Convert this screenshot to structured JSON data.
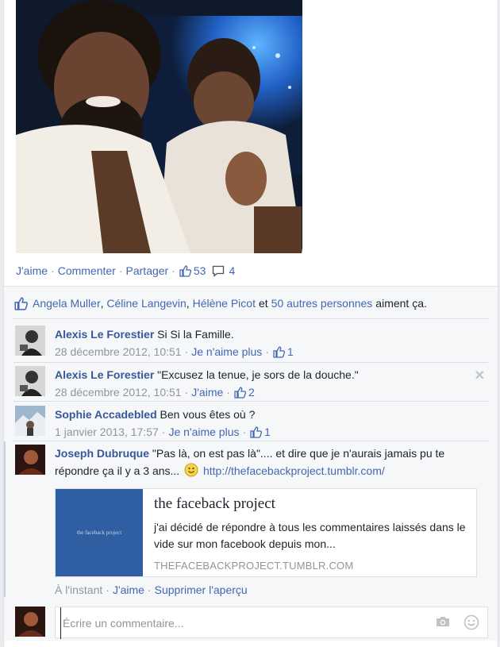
{
  "post": {
    "photo_alt": "",
    "actions": {
      "like": "J'aime",
      "comment": "Commenter",
      "share": "Partager",
      "like_count": "53",
      "comment_count": "4"
    },
    "likes": {
      "name1": "Angela Muller",
      "name2": "Céline Langevin",
      "name3": "Hélène Picot",
      "conj": "et",
      "others": "50 autres personnes",
      "suffix": "aiment ça."
    }
  },
  "comments": [
    {
      "author": "Alexis Le Forestier",
      "text": "Si Si la Famille.",
      "date": "28 décembre 2012, 10:51",
      "like_action": "Je n'aime plus",
      "likes": "1"
    },
    {
      "author": "Alexis Le Forestier",
      "text": "\"Excusez la tenue, je sors de la douche.\"",
      "date": "28 décembre 2012, 10:51",
      "like_action": "J'aime",
      "likes": "2"
    },
    {
      "author": "Sophie Accadebled",
      "text": "Ben vous êtes où ?",
      "date": "1 janvier 2013, 17:57",
      "like_action": "Je n'aime plus",
      "likes": "1"
    },
    {
      "author": "Joseph Dubruque",
      "text": "\"Pas là, on est pas là\".... et dire que je n'aurais jamais pu te répondre ça il y a 3 ans...",
      "link": "http://thefacebackproject.tumblr.com/",
      "date": "À l'instant",
      "like_action": "J'aime",
      "remove_preview": "Supprimer l'aperçu"
    }
  ],
  "preview": {
    "thumb_text": "the faceback project",
    "title": "the faceback project",
    "description": "j'ai décidé de répondre à tous les commentaires laissés dans le vide sur mon facebook depuis mon...",
    "domain": "THEFACEBACKPROJECT.TUMBLR.COM"
  },
  "composer": {
    "placeholder": "Écrire un commentaire..."
  },
  "colors": {
    "link": "#365899",
    "action": "#4267b2",
    "meta": "#90949c"
  }
}
